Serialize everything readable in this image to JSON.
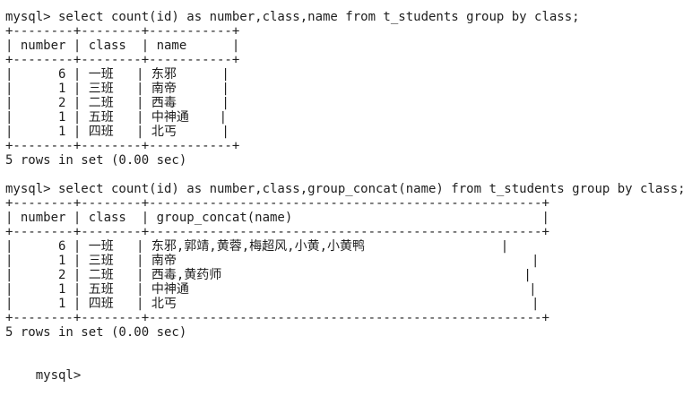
{
  "terminal": {
    "query1": {
      "command": "mysql> select count(id) as number,class,name from t_students group by class;",
      "border": "+--------+--------+-----------+",
      "header": "| number | class  | name      |",
      "rows": [
        "|      6 | 一班   | 东邪      |",
        "|      1 | 三班   | 南帝      |",
        "|      2 | 二班   | 西毒      |",
        "|      1 | 五班   | 中神通    |",
        "|      1 | 四班   | 北丐      |"
      ],
      "result": "5 rows in set (0.00 sec)"
    },
    "query2": {
      "command": "mysql> select count(id) as number,class,group_concat(name) from t_students group by class;",
      "border": "+--------+--------+----------------------------------------------------+",
      "header": "| number | class  | group_concat(name)                                 |",
      "rows": [
        "|      6 | 一班   | 东邪,郭靖,黄蓉,梅超风,小黄,小黄鸭                  |",
        "|      1 | 三班   | 南帝                                               |",
        "|      2 | 二班   | 西毒,黄药师                                        |",
        "|      1 | 五班   | 中神通                                             |",
        "|      1 | 四班   | 北丐                                               |"
      ],
      "result": "5 rows in set (0.00 sec)"
    },
    "final_prompt": "mysql>"
  }
}
